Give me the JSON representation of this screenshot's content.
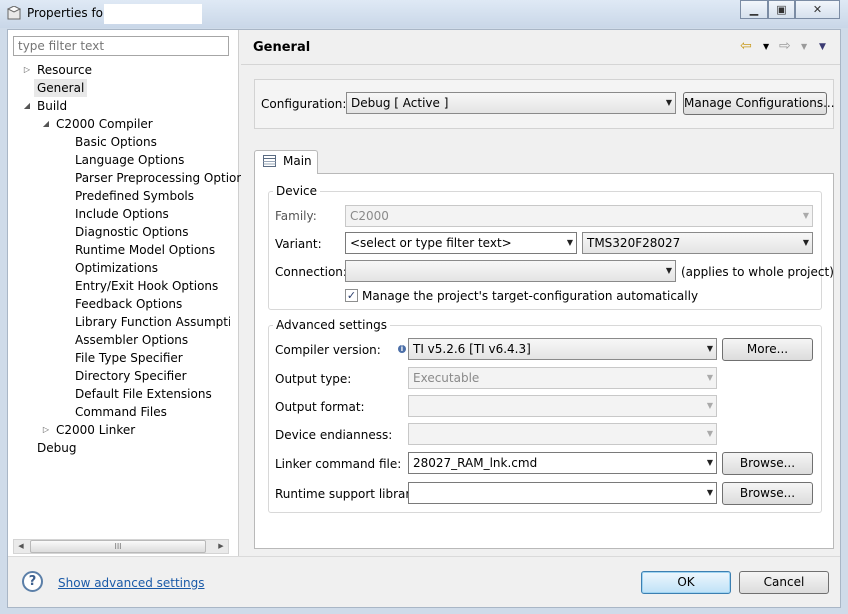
{
  "window": {
    "title": "Properties for ",
    "controls": [
      "minimize-icon",
      "maximize-icon",
      "close-icon"
    ]
  },
  "sidebar": {
    "filter_placeholder": "type filter text",
    "items": [
      {
        "label": "Resource",
        "level": 0,
        "twisty": "collapsed"
      },
      {
        "label": "General",
        "level": 0,
        "selected": true
      },
      {
        "label": "Build",
        "level": 0,
        "twisty": "expanded"
      },
      {
        "label": "C2000 Compiler",
        "level": 1,
        "twisty": "expanded"
      },
      {
        "label": "Basic Options",
        "level": 2
      },
      {
        "label": "Language Options",
        "level": 2
      },
      {
        "label": "Parser Preprocessing Options",
        "level": 2
      },
      {
        "label": "Predefined Symbols",
        "level": 2
      },
      {
        "label": "Include Options",
        "level": 2
      },
      {
        "label": "Diagnostic Options",
        "level": 2
      },
      {
        "label": "Runtime Model Options",
        "level": 2
      },
      {
        "label": "Optimizations",
        "level": 2
      },
      {
        "label": "Entry/Exit Hook Options",
        "level": 2
      },
      {
        "label": "Feedback Options",
        "level": 2
      },
      {
        "label": "Library Function Assumption",
        "level": 2
      },
      {
        "label": "Assembler Options",
        "level": 2
      },
      {
        "label": "File Type Specifier",
        "level": 2
      },
      {
        "label": "Directory Specifier",
        "level": 2
      },
      {
        "label": "Default File Extensions",
        "level": 2
      },
      {
        "label": "Command Files",
        "level": 2
      },
      {
        "label": "C2000 Linker",
        "level": 1,
        "twisty": "collapsed"
      },
      {
        "label": "Debug",
        "level": 0
      }
    ],
    "scroll_thumb_glyph": "III"
  },
  "main": {
    "title": "General",
    "configuration_label": "Configuration:",
    "configuration_value": "Debug  [ Active ]",
    "manage_configurations": "Manage Configurations...",
    "tab_main": "Main",
    "device": {
      "group_title": "Device",
      "family_label": "Family:",
      "family_value": "C2000",
      "variant_label": "Variant:",
      "variant_filter": "<select or type filter text>",
      "variant_value": "TMS320F28027",
      "connection_label": "Connection:",
      "connection_value": "",
      "connection_note": "(applies to whole project)",
      "manage_target_label": "Manage the project's target-configuration automatically",
      "manage_target_checked": true
    },
    "advanced": {
      "group_title": "Advanced settings",
      "compiler_version_label": "Compiler version:",
      "compiler_version_value": "TI v5.2.6  [TI v6.4.3]",
      "more_button": "More...",
      "output_type_label": "Output type:",
      "output_type_value": "Executable",
      "output_format_label": "Output format:",
      "output_format_value": "",
      "device_endianness_label": "Device endianness:",
      "device_endianness_value": "",
      "linker_cmd_label": "Linker command file:",
      "linker_cmd_value": "28027_RAM_lnk.cmd",
      "runtime_lib_label": "Runtime support library:",
      "runtime_lib_value": "",
      "browse_button": "Browse..."
    }
  },
  "footer": {
    "show_advanced": "Show advanced settings",
    "ok": "OK",
    "cancel": "Cancel"
  }
}
